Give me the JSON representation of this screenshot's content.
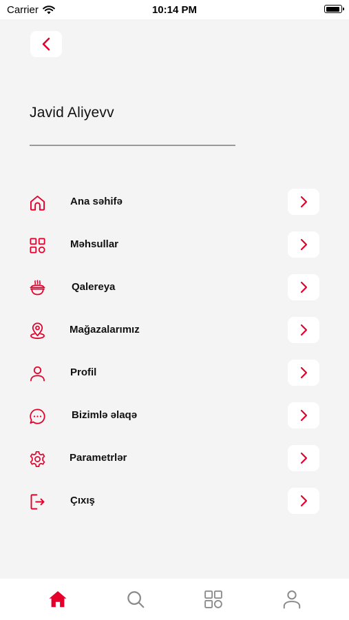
{
  "status_bar": {
    "carrier": "Carrier",
    "time": "10:14 PM",
    "battery_level": 0.95
  },
  "header": {
    "back_icon": "chevron-left-icon"
  },
  "profile": {
    "name": "Javid Aliyevv"
  },
  "menu": {
    "items": [
      {
        "label": "Ana səhifə",
        "icon": "home-icon"
      },
      {
        "label": "Məhsullar",
        "icon": "grid-icon"
      },
      {
        "label": "Qalereya",
        "icon": "food-bowl-icon"
      },
      {
        "label": "Mağazalarımız",
        "icon": "location-pin-icon"
      },
      {
        "label": "Profil",
        "icon": "user-icon"
      },
      {
        "label": "Bizimlə əlaqə",
        "icon": "chat-bubble-icon"
      },
      {
        "label": "Parametrlər",
        "icon": "gear-icon"
      },
      {
        "label": "Çıxış",
        "icon": "logout-icon"
      }
    ]
  },
  "tab_bar": {
    "tabs": [
      {
        "icon": "home-icon",
        "active": true
      },
      {
        "icon": "search-icon",
        "active": false
      },
      {
        "icon": "grid-icon",
        "active": false
      },
      {
        "icon": "user-icon",
        "active": false
      }
    ]
  },
  "colors": {
    "accent": "#e4002b",
    "inactive": "#8a8a8a",
    "background": "#f4f4f4"
  }
}
